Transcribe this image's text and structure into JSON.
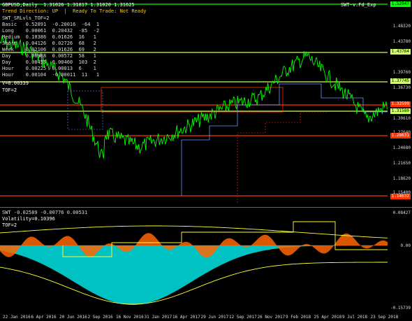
{
  "main_chart": {
    "symbol_line": "GBPUSD,Daily  1.31026 1.31817 1.31020 1.31625",
    "status": "Trend Direction: UP  |  Ready To Trade: Not Ready",
    "indicator_title": "SWT_SRLvls_TOF=2",
    "top_right_label": "SWT-v.Fd_Exp",
    "table_rows": [
      {
        "name": "Basic",
        "a": "0.52891",
        "b": "-0.20016",
        "c": "-64",
        "d": "1"
      },
      {
        "name": "Long",
        "a": "0.00061",
        "b": "0.20432",
        "c": "-85",
        "d": "-2"
      },
      {
        "name": "Medium",
        "a": "0.10386",
        "b": "0.01626",
        "c": "16",
        "d": "1"
      },
      {
        "name": "Short",
        "a": "0.04126",
        "b": "0.02726",
        "c": "68",
        "d": "2"
      },
      {
        "name": "Week",
        "a": "0.02106",
        "b": "0.01626",
        "c": "69",
        "d": "2"
      },
      {
        "name": "Day",
        "a": "0.00988",
        "b": "0.00572",
        "c": "58",
        "d": "1"
      },
      {
        "name": "Day",
        "a": "0.00455",
        "b": "0.00460",
        "c": "103",
        "d": "2"
      },
      {
        "name": "Hour",
        "a": "0.00225",
        "b": "0.00013",
        "c": "6",
        "d": "1"
      },
      {
        "name": "Hour",
        "a": "0.00104",
        "b": "-0.00011",
        "c": "11",
        "d": "1"
      }
    ],
    "v_line": "V=0.00339",
    "tof_line": "TOF=2",
    "price_ticks": [
      "1.48320",
      "1.43780",
      "1.39760",
      "1.36730",
      "1.30610",
      "1.27640",
      "1.24680",
      "1.21650",
      "1.18620",
      "1.15400"
    ],
    "price_badges": [
      {
        "value": "1.52947",
        "color": "#00ff00",
        "text_color": "#000"
      },
      {
        "value": "1.43764",
        "color": "#ccff66",
        "text_color": "#000"
      },
      {
        "value": "1.37745",
        "color": "#ccff66",
        "text_color": "#000"
      },
      {
        "value": "1.32599",
        "color": "#ff3300",
        "text_color": "#fff"
      },
      {
        "value": "1.31580",
        "color": "#ccff66",
        "text_color": "#000"
      },
      {
        "value": "1.28631",
        "color": "#ff3300",
        "text_color": "#fff"
      },
      {
        "value": "1.14632",
        "color": "#ff3300",
        "text_color": "#fff"
      }
    ]
  },
  "sub_chart": {
    "title": "SWT -0.02589 -0.00776 0.00531",
    "volatility": "Volatility=0.10396",
    "tof": "TOF=2",
    "ticks": [
      "0.08427",
      "0.00",
      "-0.15739"
    ]
  },
  "x_axis": [
    "22 Jan 2016",
    "6 Apr 2016",
    "20 Jun 2016",
    "2 Sep 2016",
    "16 Nov 2016",
    "31 Jan 2017",
    "16 Apr 2017",
    "29 Jun 2017",
    "12 Sep 2017",
    "26 Nov 2017",
    "9 Feb 2018",
    "25 Apr 2018",
    "9 Jul 2018",
    "23 Sep 2018"
  ],
  "colors": {
    "price": "#00ff00",
    "support": "#ff3300",
    "resistance": "#ccff66",
    "area_cyan": "#00cccc",
    "area_orange": "#ff6600",
    "envelope": "#ffff33",
    "blue": "#6699ff"
  }
}
